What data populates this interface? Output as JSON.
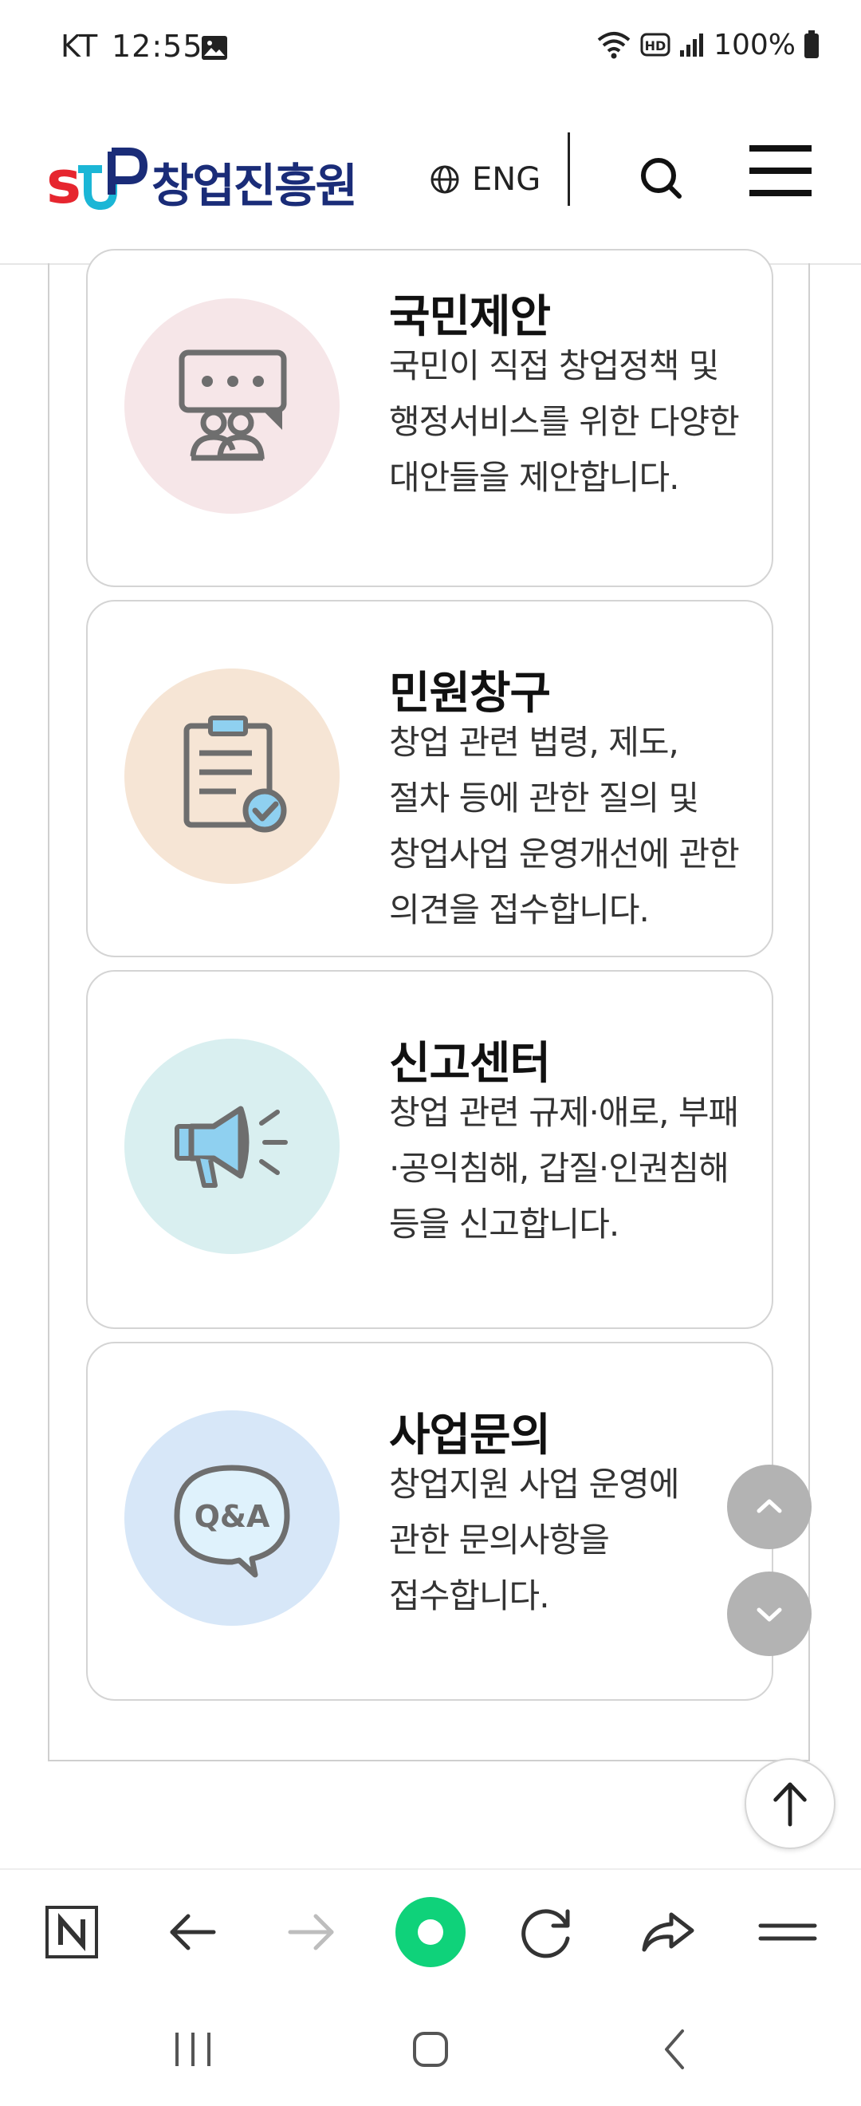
{
  "status_bar": {
    "carrier": "KT",
    "time": "12:55",
    "battery": "100%",
    "icons": [
      "photo-icon",
      "wifi-icon",
      "hd-icon",
      "signal-icon",
      "battery-icon"
    ]
  },
  "header": {
    "logo_mark": "stP",
    "logo_text": "창업진흥원",
    "lang_label": "ENG",
    "icons": [
      "globe-icon",
      "search-icon",
      "hamburger-menu-icon"
    ]
  },
  "cards": [
    {
      "title": "국민제안",
      "desc": "국민이 직접 창업정책 및 행정서비스를 위한 다양한 대안들을 제안합니다.",
      "icon": "speech-people-icon",
      "circle_color": "#f6e6e8"
    },
    {
      "title": "민원창구",
      "desc": "창업 관련 법령, 제도, 절차 등에 관한 질의 및 창업사업 운영개선에 관한 의견을 접수합니다.",
      "icon": "clipboard-check-icon",
      "circle_color": "#f6e5d5"
    },
    {
      "title": "신고센터",
      "desc": "창업 관련 규제·애로, 부패·공익침해, 갑질·인권침해 등을 신고합니다.",
      "icon": "megaphone-icon",
      "circle_color": "#d9eff0"
    },
    {
      "title": "사업문의",
      "desc": "창업지원 사업 운영에 관한 문의사항을 접수합니다.",
      "icon": "qna-bubble-icon",
      "icon_text": "Q&A",
      "circle_color": "#d7e7f8"
    }
  ],
  "floating": {
    "icons": [
      "chevron-up-icon",
      "chevron-down-icon",
      "arrow-up-icon"
    ]
  },
  "browser_toolbar": {
    "icons": [
      "naver-home-icon",
      "back-arrow-icon",
      "forward-arrow-icon",
      "green-dot-icon",
      "refresh-icon",
      "share-icon",
      "menu-lines-icon"
    ]
  },
  "system_nav": {
    "icons": [
      "recent-apps-icon",
      "home-icon",
      "back-icon"
    ]
  }
}
